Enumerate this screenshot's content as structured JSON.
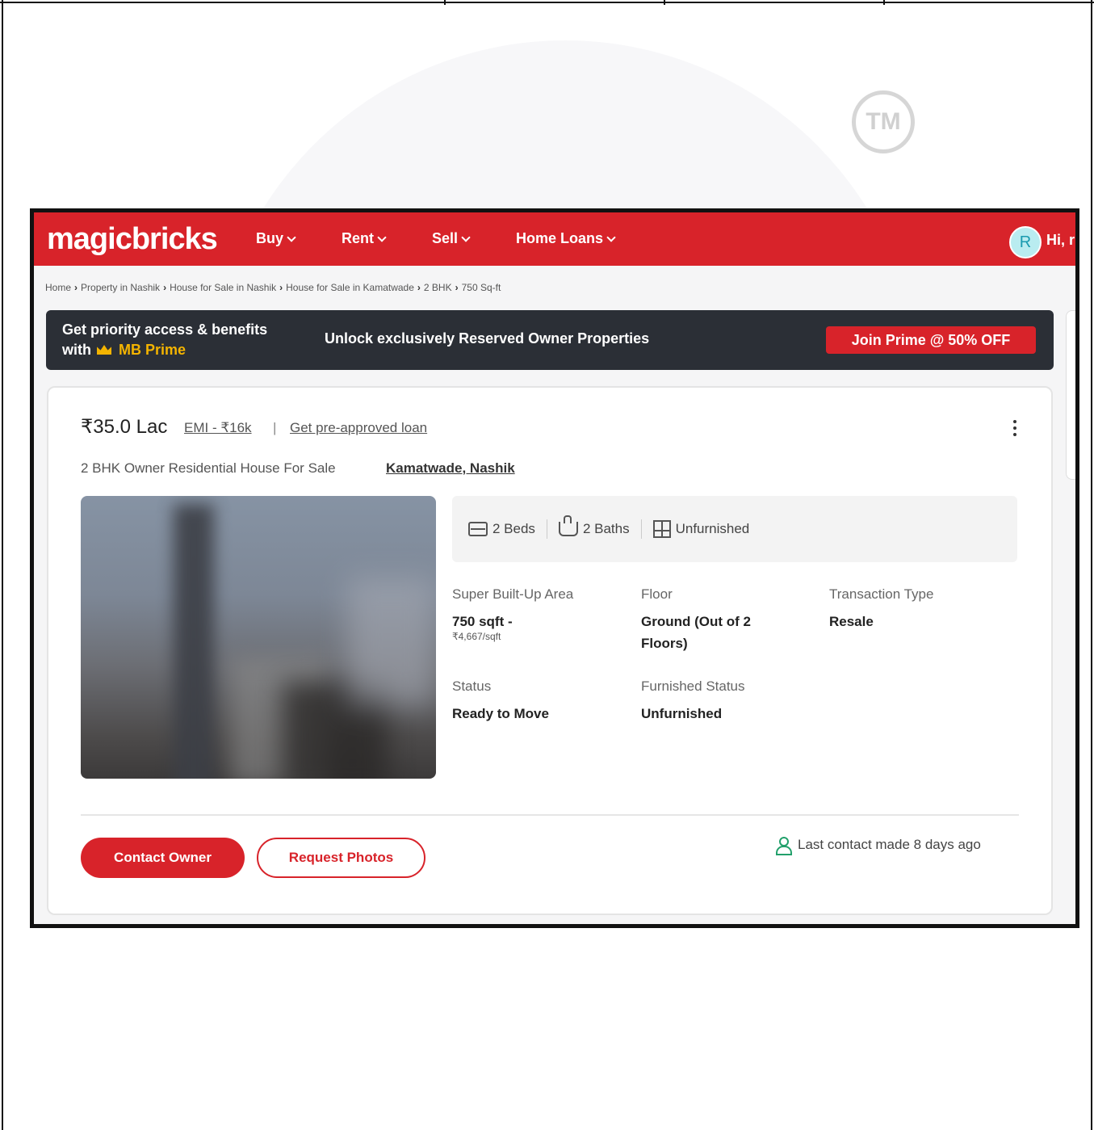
{
  "watermark": {
    "tm": "TM"
  },
  "header": {
    "logo": "magicbricks",
    "nav": [
      {
        "label": "Buy"
      },
      {
        "label": "Rent"
      },
      {
        "label": "Sell"
      },
      {
        "label": "Home Loans"
      }
    ],
    "avatar_initial": "R",
    "greeting": "Hi, r"
  },
  "breadcrumb": [
    "Home",
    "Property in Nashik",
    "House for Sale in Nashik",
    "House for Sale in Kamatwade",
    "2 BHK",
    "750 Sq-ft"
  ],
  "prime_banner": {
    "line1": "Get priority access & benefits",
    "line2_prefix": "with",
    "brand": "MB Prime",
    "headline": "Unlock exclusively Reserved Owner Properties",
    "cta": "Join Prime @ 50% OFF"
  },
  "listing": {
    "price": "₹35.0 Lac",
    "emi": "EMI - ₹16k",
    "separator": "|",
    "loan_link": "Get pre-approved loan",
    "subtitle": "2 BHK Owner Residential House For Sale",
    "locality": "Kamatwade, Nashik",
    "amenities": {
      "beds": "2 Beds",
      "baths": "2 Baths",
      "furnishing": "Unfurnished"
    },
    "specs": {
      "area_label": "Super Built-Up Area",
      "area_value": "750 sqft -",
      "area_rate": "₹4,667/sqft",
      "floor_label": "Floor",
      "floor_value_1": "Ground (Out of 2",
      "floor_value_2": "Floors)",
      "transaction_label": "Transaction Type",
      "transaction_value": "Resale",
      "status_label": "Status",
      "status_value": "Ready to Move",
      "furnished_label": "Furnished Status",
      "furnished_value": "Unfurnished"
    },
    "contact_button": "Contact Owner",
    "photos_button": "Request Photos",
    "last_contact": "Last contact made 8 days ago"
  },
  "colors": {
    "brand_red": "#d8232a",
    "banner_dark": "#2b2f36",
    "prime_gold": "#f4b400",
    "contact_icon_green": "#22a06b"
  }
}
